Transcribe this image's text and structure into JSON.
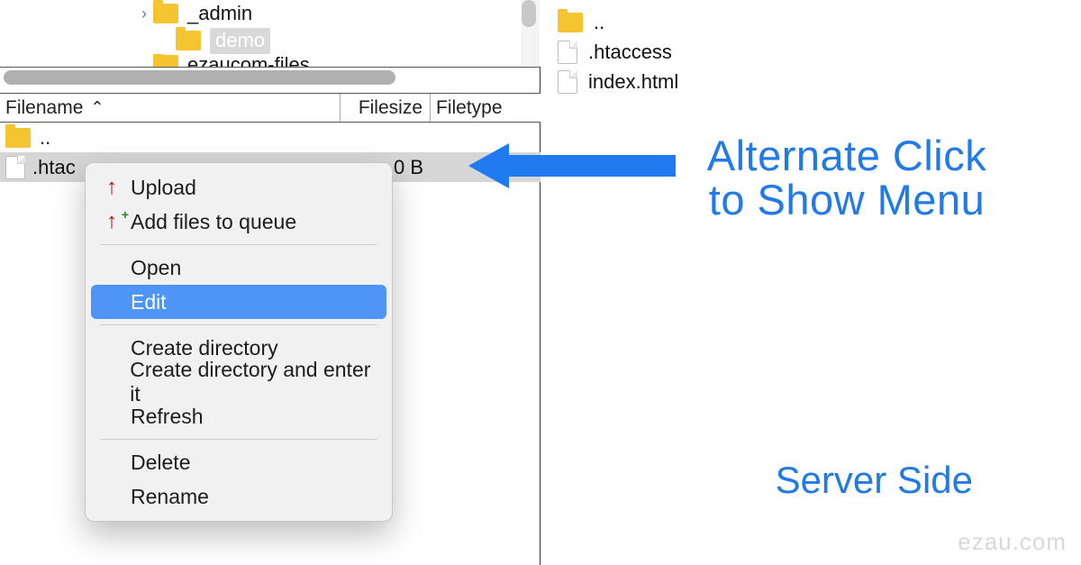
{
  "left": {
    "tree": {
      "row1": {
        "disclosure": "›",
        "name": "_admin"
      },
      "row2": {
        "name": "demo"
      },
      "row3": {
        "disclosure": "⌄",
        "name_partial": "ezaucom-files"
      }
    },
    "columns": {
      "filename": "Filename",
      "sort_glyph": "⌃",
      "filesize": "Filesize",
      "filetype": "Filetype"
    },
    "files": {
      "parent": "..",
      "selected": {
        "name_partial": ".htac",
        "size": "0 B"
      }
    }
  },
  "context_menu": {
    "upload": "Upload",
    "add_queue": "Add files to queue",
    "open": "Open",
    "edit": "Edit",
    "create_dir": "Create directory",
    "create_dir_enter": "Create directory and enter it",
    "refresh": "Refresh",
    "delete": "Delete",
    "rename": "Rename"
  },
  "right": {
    "parent": "..",
    "f1": ".htaccess",
    "f2": "index.html"
  },
  "annotations": {
    "alt_click_l1": "Alternate Click",
    "alt_click_l2": "to Show Menu",
    "server_side": "Server Side",
    "watermark": "ezau.com"
  }
}
